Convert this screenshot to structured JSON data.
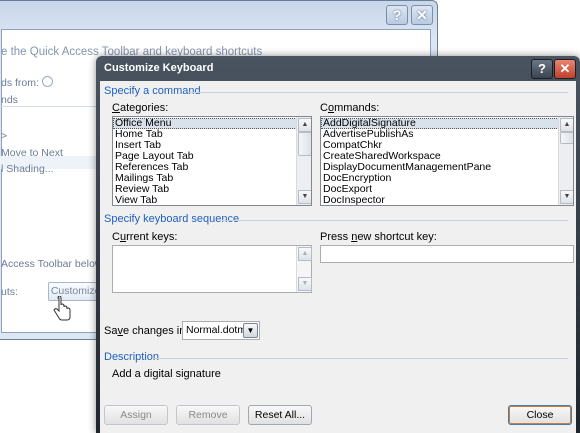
{
  "background_window": {
    "title_buttons": [
      "?",
      "✕"
    ],
    "heading_fragment": "e the Quick Access Toolbar and keyboard shortcuts",
    "choose_from_label": "ds from:",
    "info_icon": "info-circle-icon",
    "choose_from_value": "nds",
    "list_items": [
      ">",
      "Move to Next",
      "l Shading..."
    ],
    "toolbar_below_text": "Access Toolbar below t",
    "shortcuts_label": "uts:",
    "customize_button": "Customize..."
  },
  "dialog": {
    "title": "Customize Keyboard",
    "help_glyph": "?",
    "close_glyph": "✕",
    "specify_command_label": "Specify a command",
    "categories_label": "Categories:",
    "categories": [
      "Office Menu",
      "Home Tab",
      "Insert Tab",
      "Page Layout Tab",
      "References Tab",
      "Mailings Tab",
      "Review Tab",
      "View Tab"
    ],
    "categories_selected": "Office Menu",
    "commands_label": "Commands:",
    "commands": [
      "AddDigitalSignature",
      "AdvertisePublishAs",
      "CompatChkr",
      "CreateSharedWorkspace",
      "DisplayDocumentManagementPane",
      "DocEncryption",
      "DocExport",
      "DocInspector"
    ],
    "commands_selected": "AddDigitalSignature",
    "specify_keyboard_label": "Specify keyboard sequence",
    "current_keys_label": "Current keys:",
    "new_shortcut_label": "Press new shortcut key:",
    "new_shortcut_value": "",
    "save_changes_label": "Save changes in:",
    "save_changes_value": "Normal.dotm",
    "description_label": "Description",
    "description_text": "Add a digital signature",
    "buttons": {
      "assign": "Assign",
      "remove": "Remove",
      "reset_all": "Reset All...",
      "close": "Close"
    }
  }
}
